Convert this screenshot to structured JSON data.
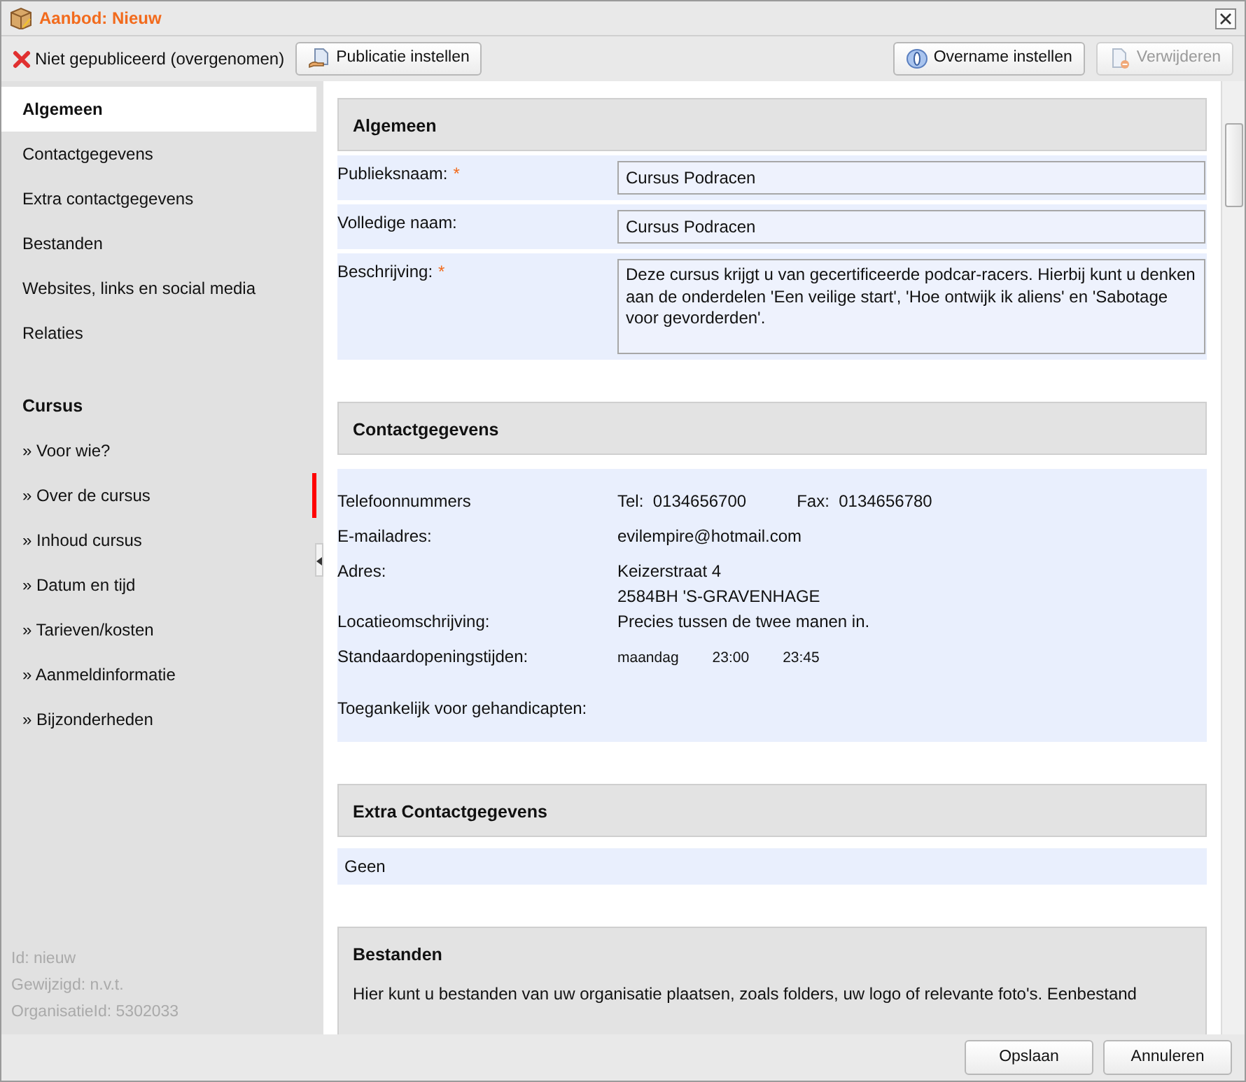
{
  "window": {
    "title": "Aanbod: Nieuw"
  },
  "toolbar": {
    "status": "Niet gepubliceerd (overgenomen)",
    "left_buttons": [
      {
        "label": "Publicatie instellen",
        "disabled": false,
        "kind": "publish"
      }
    ],
    "right_buttons": [
      {
        "label": "Overname instellen",
        "disabled": false,
        "kind": "takeover"
      },
      {
        "label": "Verwijderen",
        "disabled": true,
        "kind": "delete"
      }
    ]
  },
  "sidebar": {
    "groups": [
      {
        "items": [
          {
            "label": "Algemeen",
            "selected": true,
            "marked": false
          },
          {
            "label": "Contactgegevens",
            "selected": false,
            "marked": false
          },
          {
            "label": "Extra contactgegevens",
            "selected": false,
            "marked": false
          },
          {
            "label": "Bestanden",
            "selected": false,
            "marked": false
          },
          {
            "label": "Websites, links en social media",
            "selected": false,
            "marked": false
          },
          {
            "label": "Relaties",
            "selected": false,
            "marked": false
          }
        ]
      },
      {
        "heading": "Cursus",
        "items": [
          {
            "label": "» Voor wie?",
            "selected": false,
            "marked": false
          },
          {
            "label": "» Over de cursus",
            "selected": false,
            "marked": true
          },
          {
            "label": "» Inhoud cursus",
            "selected": false,
            "marked": false
          },
          {
            "label": "» Datum en tijd",
            "selected": false,
            "marked": false
          },
          {
            "label": "» Tarieven/kosten",
            "selected": false,
            "marked": false
          },
          {
            "label": "» Aanmeldinformatie",
            "selected": false,
            "marked": false
          },
          {
            "label": "» Bijzonderheden",
            "selected": false,
            "marked": false
          }
        ]
      }
    ],
    "meta": [
      "Id: nieuw",
      "Gewijzigd: n.v.t.",
      "OrganisatieId: 5302033"
    ]
  },
  "sections": [
    {
      "kind": "form",
      "title": "Algemeen",
      "fields": [
        {
          "kind": "input",
          "label": "Publieksnaam:",
          "required_mark": "*",
          "value": "Cursus Podracen"
        },
        {
          "kind": "input",
          "label": "Volledige naam:",
          "value": "Cursus Podracen"
        },
        {
          "kind": "textarea",
          "label": "Beschrijving:",
          "required_mark": "*",
          "value": "Deze cursus krijgt u van gecertificeerde podcar-racers. Hierbij kunt u denken aan de onderdelen 'Een veilige start', 'Hoe ontwijk ik aliens' en 'Sabotage voor gevorderden'."
        }
      ]
    },
    {
      "kind": "details",
      "title": "Contactgegevens",
      "rows": [
        {
          "kind": "pairs",
          "label": "Telefoonnummers",
          "pairs": [
            {
              "label": "Tel:",
              "value": "0134656700"
            },
            {
              "label": "Fax:",
              "value": "0134656780"
            }
          ]
        },
        {
          "kind": "lines",
          "label": "E-mailadres:",
          "lines": [
            "evilempire@hotmail.com"
          ]
        },
        {
          "kind": "lines",
          "label": "Adres:",
          "lines": [
            "Keizerstraat 4",
            "2584BH 'S-GRAVENHAGE"
          ]
        },
        {
          "kind": "lines",
          "label": "Locatieomschrijving:",
          "lines": [
            "Precies tussen de twee manen in."
          ]
        },
        {
          "kind": "cells",
          "label": "Standaardopeningstijden:",
          "cells": [
            "maandag",
            "23:00",
            "23:45"
          ]
        },
        {
          "kind": "lines",
          "label": "Toegankelijk voor gehandicapten:"
        }
      ]
    },
    {
      "kind": "text",
      "title": "Extra Contactgegevens",
      "text": "Geen"
    },
    {
      "kind": "note",
      "title": "Bestanden",
      "text": "Hier kunt u bestanden van uw organisatie plaatsen, zoals folders, uw logo of relevante foto's. Eenbestand"
    }
  ],
  "footer": {
    "buttons": [
      "Opslaan",
      "Annuleren"
    ]
  }
}
